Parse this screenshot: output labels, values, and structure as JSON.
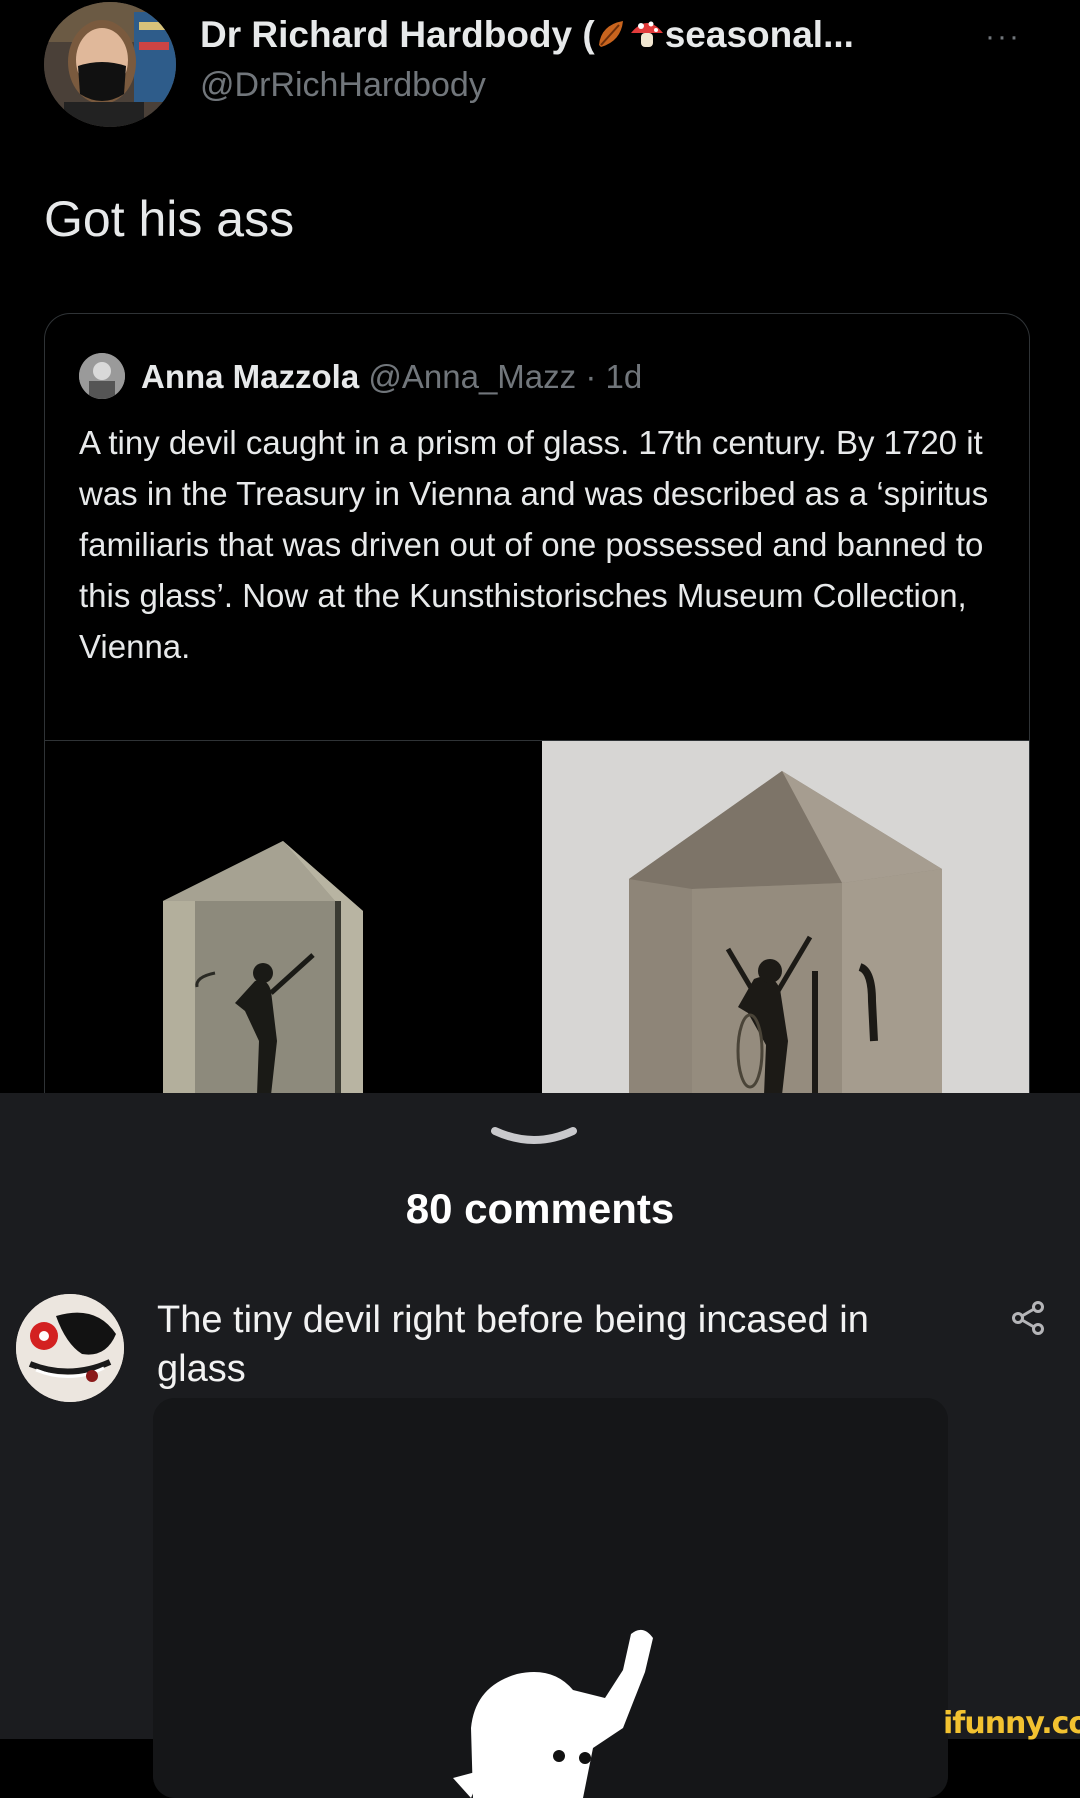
{
  "tweet": {
    "display_name": "Dr Richard Hardbody (",
    "display_name_suffix": "seasonal...",
    "name_emojis": [
      "leaf-icon",
      "mushroom-icon"
    ],
    "handle": "@DrRichHardbody",
    "more_label": "···",
    "text": "Got his ass"
  },
  "quote": {
    "name": "Anna Mazzola",
    "handle": "@Anna_Mazz",
    "separator": "·",
    "time": "1d",
    "text": "A tiny devil caught in a prism of glass.  17th century. By 1720 it was in the Treasury in Vienna and was described as a ‘spiritus familiaris that was driven out of one possessed and banned to this glass’. Now at the Kunsthistorisches Museum Collection, Vienna."
  },
  "comments": {
    "count_label": "80 comments",
    "items": [
      {
        "text": "The tiny devil right before being incased in glass"
      }
    ]
  },
  "watermark": "ifunny.co",
  "colors": {
    "background": "#000000",
    "sheet": "#1b1c1f",
    "text": "#e7e9ea",
    "muted": "#71767b",
    "border": "#2f3336",
    "watermark": "#f2c230"
  }
}
